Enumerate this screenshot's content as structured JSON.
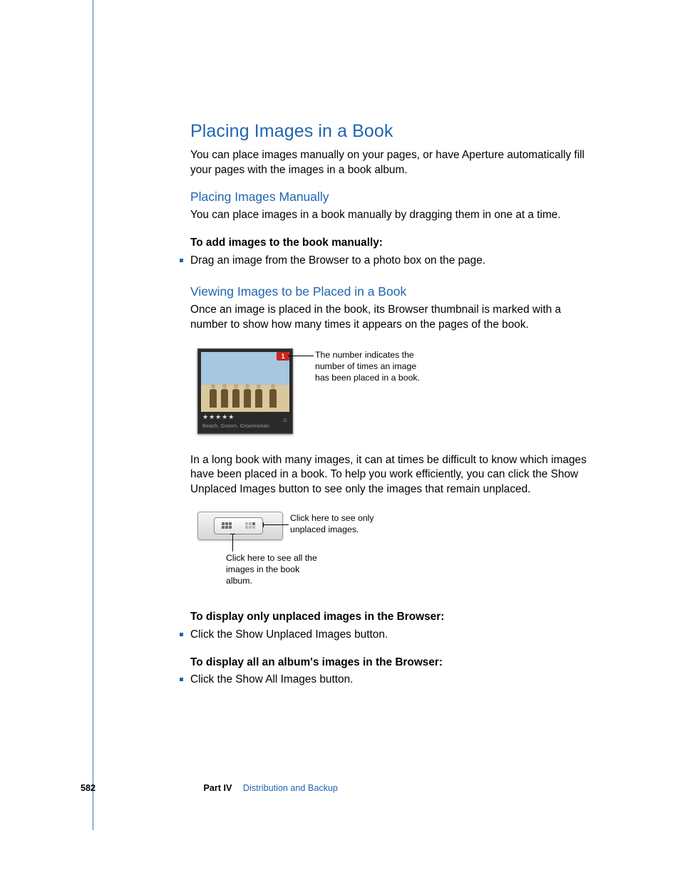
{
  "headings": {
    "h1": "Placing Images in a Book",
    "h2a": "Placing Images Manually",
    "h2b": "Viewing Images to be Placed in a Book"
  },
  "paragraphs": {
    "intro": "You can place images manually on your pages, or have Aperture automatically fill your pages with the images in a book album.",
    "manual": "You can place images in a book manually by dragging them in one at a time.",
    "task_add": "To add images to the book manually:",
    "bullet_add": "Drag an image from the Browser to a photo box on the page.",
    "viewing1": "Once an image is placed in the book, its Browser thumbnail is marked with a number to show how many times it appears on the pages of the book.",
    "viewing2": "In a long book with many images, it can at times be difficult to know which images have been placed in a book. To help you work efficiently, you can click the Show Unplaced Images button to see only the images that remain unplaced.",
    "task_unplaced": "To display only unplaced images in the Browser:",
    "bullet_unplaced": "Click the Show Unplaced Images button.",
    "task_all": "To display all an album's images in the Browser:",
    "bullet_all": "Click the Show All Images button."
  },
  "thumb": {
    "badge": "1",
    "stars": "★★★★★",
    "caption": "Beach, Groom, Groomsman",
    "callout": "The number indicates the number of times an image has been placed in a book."
  },
  "toolbar": {
    "callout_right": "Click here to see only unplaced images.",
    "callout_bottom": "Click here to see all the images in the book album."
  },
  "footer": {
    "page": "582",
    "part": "Part IV",
    "section": "Distribution and Backup"
  }
}
